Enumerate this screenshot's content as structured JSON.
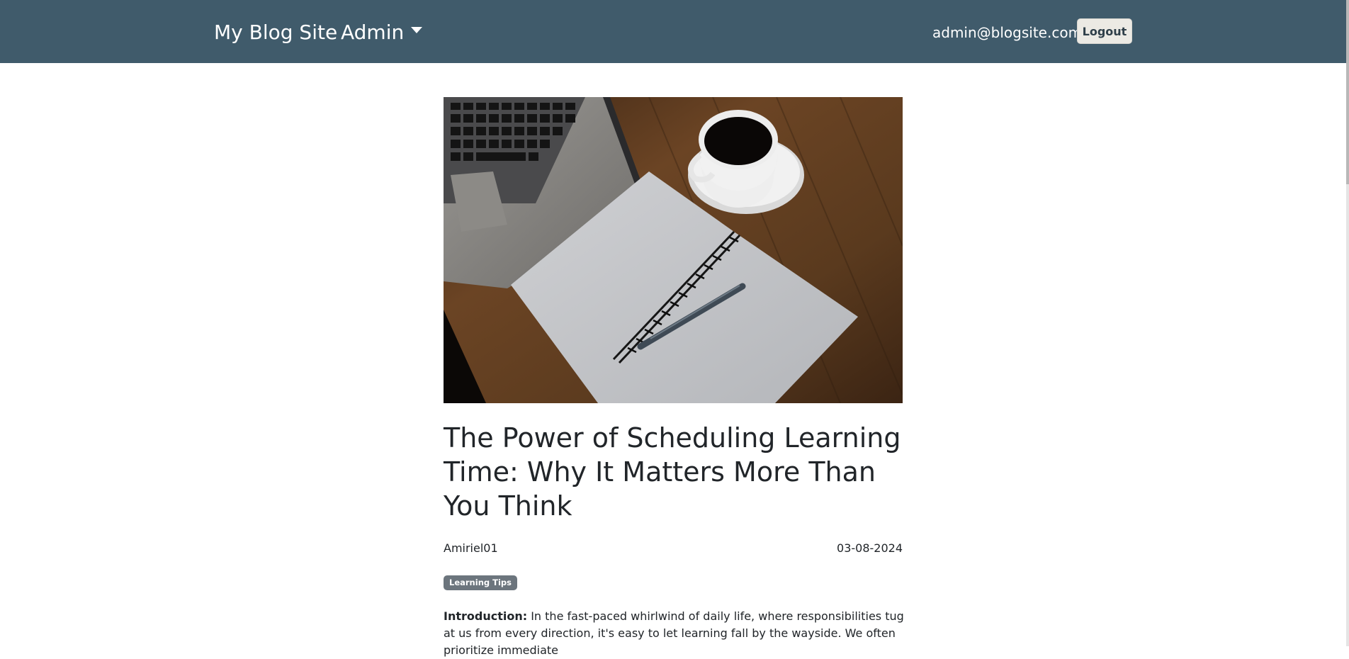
{
  "navbar": {
    "brand": "My Blog Site",
    "admin_menu": "Admin",
    "user_email": "admin@blogsite.com",
    "logout_label": "Logout"
  },
  "post": {
    "image_alt": "Laptop, notebook with pen, and cup of coffee on a wooden desk",
    "title": "The Power of Scheduling Learning Time: Why It Matters More Than You Think",
    "author": "Amiriel01",
    "date": "03-08-2024",
    "category": "Learning Tips",
    "intro_label": "Introduction:",
    "intro_text": " In the fast-paced whirlwind of daily life, where responsibilities tug at us from every direction, it's easy to let learning fall by the wayside. We often prioritize immediate"
  },
  "colors": {
    "navbar_bg": "#405b6b",
    "badge_bg": "#6c757d"
  }
}
